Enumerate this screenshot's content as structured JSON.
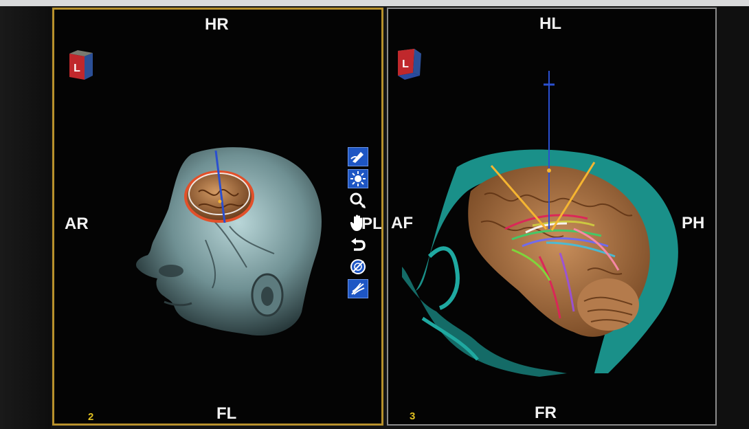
{
  "viewports": [
    {
      "number": "2",
      "labels": {
        "top": "HR",
        "bottom": "FL",
        "left": "AR",
        "right": "PL"
      },
      "cube_letter": "L",
      "highlight_color": "#b8912c"
    },
    {
      "number": "3",
      "labels": {
        "top": "HL",
        "bottom": "FR",
        "left": "AF",
        "right": "PH"
      },
      "cube_letter": "L",
      "highlight_color": "#8b8b8b"
    }
  ],
  "toolbar": {
    "tools": [
      {
        "name": "pen-icon",
        "active": true
      },
      {
        "name": "brightness-icon",
        "active": true
      },
      {
        "name": "zoom-icon",
        "active": false
      },
      {
        "name": "pan-hand-icon",
        "active": false
      },
      {
        "name": "undo-icon",
        "active": false
      },
      {
        "name": "no-entry-icon",
        "active": false
      },
      {
        "name": "fiber-tract-icon",
        "active": true
      }
    ]
  },
  "colors": {
    "accent_active": "#1e56c4",
    "cube_red": "#c0282c",
    "orientation_text": "#f2f2f2",
    "viewport_number": "#e0c020",
    "trajectory_line": "#f5b531",
    "skin_cyan": "#1fa9a1",
    "brain_tan": "#b0764a"
  }
}
